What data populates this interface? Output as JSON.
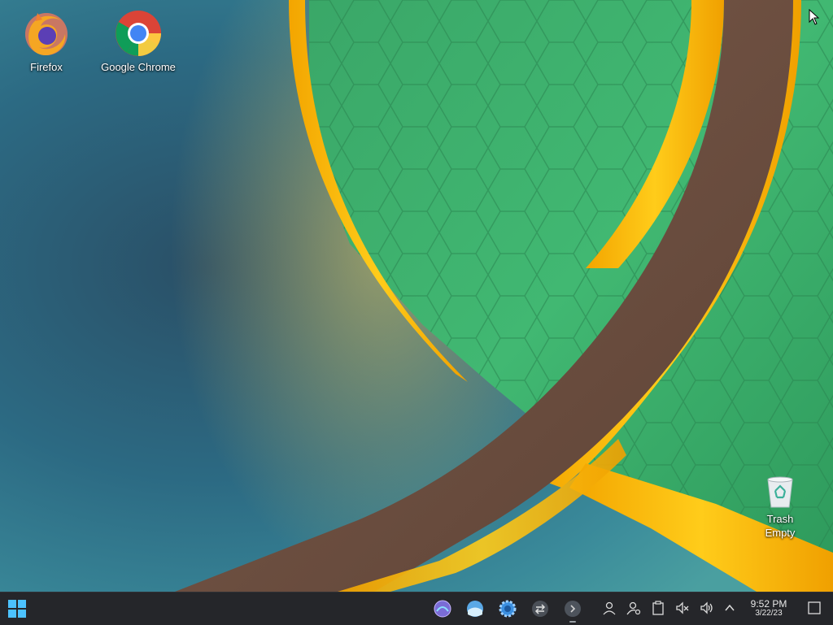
{
  "desktop": {
    "icons": [
      {
        "label": "Firefox",
        "icon": "firefox-icon"
      },
      {
        "label": "Google Chrome",
        "icon": "chrome-icon"
      },
      {
        "label": "Trash\nEmpty",
        "icon": "trash-icon"
      }
    ]
  },
  "taskbar": {
    "start_icon": "windows-start-icon",
    "apps": [
      "app-launcher-icon",
      "weather-app-icon",
      "settings-gear-icon",
      "switcher-icon",
      "arrow-app-icon"
    ],
    "tray": [
      "user-icon",
      "user-settings-icon",
      "clipboard-icon",
      "mute-icon",
      "volume-icon",
      "chevron-up-icon"
    ],
    "clock": {
      "time": "9:52 PM",
      "date": "3/22/23"
    },
    "show_desktop_icon": "show-desktop-icon"
  }
}
